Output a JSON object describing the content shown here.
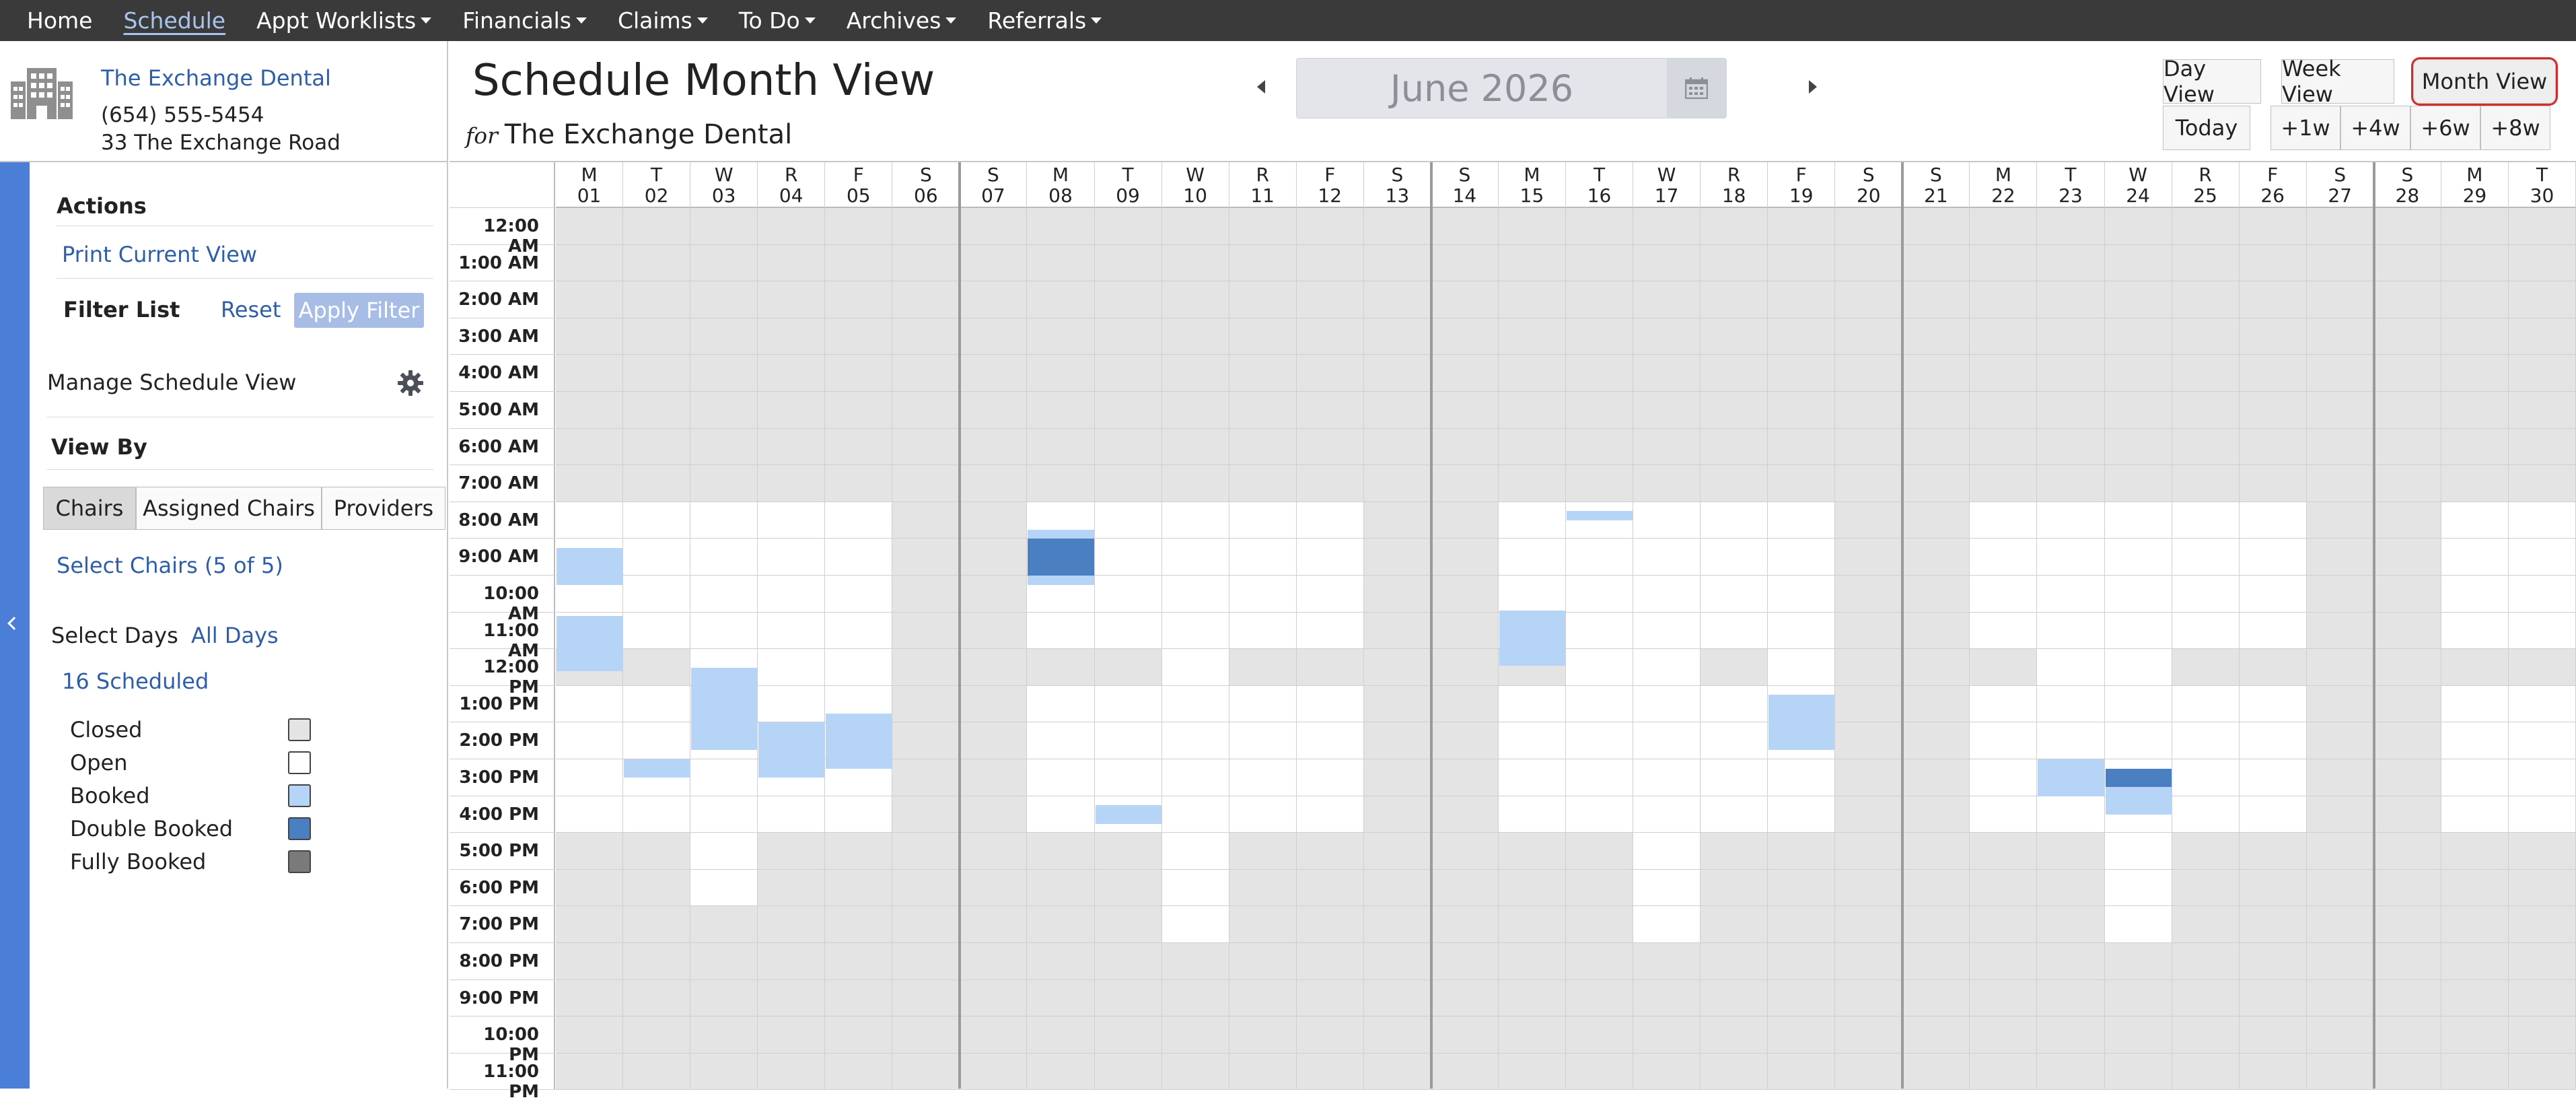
{
  "nav": {
    "items": [
      {
        "label": "Home",
        "dropdown": false,
        "active": false
      },
      {
        "label": "Schedule",
        "dropdown": false,
        "active": true
      },
      {
        "label": "Appt Worklists",
        "dropdown": true,
        "active": false
      },
      {
        "label": "Financials",
        "dropdown": true,
        "active": false
      },
      {
        "label": "Claims",
        "dropdown": true,
        "active": false
      },
      {
        "label": "To Do",
        "dropdown": true,
        "active": false
      },
      {
        "label": "Archives",
        "dropdown": true,
        "active": false
      },
      {
        "label": "Referrals",
        "dropdown": true,
        "active": false
      }
    ]
  },
  "office": {
    "name": "The Exchange Dental",
    "phone": "(654) 555-5454",
    "address": "33 The Exchange Road"
  },
  "header": {
    "title": "Schedule Month View",
    "for_label": "for",
    "location": "The Exchange Dental",
    "month": "June 2026",
    "views": [
      "Day View",
      "Week View",
      "Month View"
    ],
    "selected_view": "Month View",
    "today_label": "Today",
    "jumps": [
      "+1w",
      "+4w",
      "+6w",
      "+8w"
    ]
  },
  "sidebar": {
    "actions_title": "Actions",
    "print_label": "Print Current View",
    "filter_list_label": "Filter List",
    "reset_label": "Reset",
    "apply_label": "Apply Filter",
    "manage_label": "Manage Schedule View",
    "view_by_label": "View By",
    "view_by_options": [
      "Chairs",
      "Assigned Chairs",
      "Providers"
    ],
    "view_by_selected": "Chairs",
    "select_chairs_label": "Select Chairs (5 of 5)",
    "select_days_label": "Select Days",
    "all_days_label": "All Days",
    "scheduled_label": "16 Scheduled",
    "legend": [
      {
        "label": "Closed",
        "color": "#e4e4e4"
      },
      {
        "label": "Open",
        "color": "#ffffff"
      },
      {
        "label": "Booked",
        "color": "#b6d5f6"
      },
      {
        "label": "Double Booked",
        "color": "#4a7fc1"
      },
      {
        "label": "Fully Booked",
        "color": "#7a7a7a"
      }
    ]
  },
  "calendar": {
    "days": [
      {
        "dow": "M",
        "date": "01"
      },
      {
        "dow": "T",
        "date": "02"
      },
      {
        "dow": "W",
        "date": "03"
      },
      {
        "dow": "R",
        "date": "04"
      },
      {
        "dow": "F",
        "date": "05"
      },
      {
        "dow": "S",
        "date": "06"
      },
      {
        "dow": "S",
        "date": "07"
      },
      {
        "dow": "M",
        "date": "08"
      },
      {
        "dow": "T",
        "date": "09"
      },
      {
        "dow": "W",
        "date": "10"
      },
      {
        "dow": "R",
        "date": "11"
      },
      {
        "dow": "F",
        "date": "12"
      },
      {
        "dow": "S",
        "date": "13"
      },
      {
        "dow": "S",
        "date": "14"
      },
      {
        "dow": "M",
        "date": "15"
      },
      {
        "dow": "T",
        "date": "16"
      },
      {
        "dow": "W",
        "date": "17"
      },
      {
        "dow": "R",
        "date": "18"
      },
      {
        "dow": "F",
        "date": "19"
      },
      {
        "dow": "S",
        "date": "20"
      },
      {
        "dow": "S",
        "date": "21"
      },
      {
        "dow": "M",
        "date": "22"
      },
      {
        "dow": "T",
        "date": "23"
      },
      {
        "dow": "W",
        "date": "24"
      },
      {
        "dow": "R",
        "date": "25"
      },
      {
        "dow": "F",
        "date": "26"
      },
      {
        "dow": "S",
        "date": "27"
      },
      {
        "dow": "S",
        "date": "28"
      },
      {
        "dow": "M",
        "date": "29"
      },
      {
        "dow": "T",
        "date": "30"
      }
    ],
    "hours": [
      "12:00 AM",
      "1:00 AM",
      "2:00 AM",
      "3:00 AM",
      "4:00 AM",
      "5:00 AM",
      "6:00 AM",
      "7:00 AM",
      "8:00 AM",
      "9:00 AM",
      "10:00 AM",
      "11:00 AM",
      "12:00 PM",
      "1:00 PM",
      "2:00 PM",
      "3:00 PM",
      "4:00 PM",
      "5:00 PM",
      "6:00 PM",
      "7:00 PM",
      "8:00 PM",
      "9:00 PM",
      "10:00 PM",
      "11:00 PM"
    ],
    "open_hours": {
      "01": [
        8,
        12
      ],
      "02": [
        8,
        17
      ],
      "03": [
        8,
        19
      ],
      "04": [
        8,
        17
      ],
      "05": [
        8,
        17
      ],
      "08": [
        8,
        12
      ],
      "09": [
        8,
        17
      ],
      "10": [
        8,
        20
      ],
      "11": [
        8,
        12
      ],
      "12": [
        8,
        12
      ],
      "15": [
        8,
        12
      ],
      "16": [
        8,
        17
      ],
      "17": [
        8,
        20
      ],
      "18": [
        8,
        12
      ],
      "19": [
        8,
        17
      ],
      "22": [
        8,
        12
      ],
      "23": [
        8,
        17
      ],
      "24": [
        8,
        20
      ],
      "25": [
        8,
        12
      ],
      "26": [
        8,
        12
      ],
      "29": [
        8,
        12
      ],
      "30": [
        8,
        12
      ]
    },
    "closed_gaps": {
      "01": [
        [
          12,
          13
        ],
        [
          17,
          24
        ]
      ],
      "02": [
        [
          12,
          13
        ],
        [
          17,
          24
        ]
      ],
      "08": [
        [
          12,
          13
        ]
      ],
      "09": [
        [
          12,
          13
        ]
      ],
      "11": [
        [
          12,
          13
        ]
      ],
      "12": [
        [
          12,
          13
        ]
      ],
      "15": [
        [
          12,
          13
        ]
      ],
      "18": [
        [
          12,
          13
        ]
      ],
      "22": [
        [
          12,
          13
        ]
      ],
      "25": [
        [
          12,
          13
        ]
      ],
      "26": [
        [
          12,
          13
        ]
      ],
      "29": [
        [
          12,
          13
        ]
      ],
      "30": [
        [
          12,
          13
        ]
      ]
    },
    "extra_open": {
      "01": [
        [
          13,
          17
        ]
      ],
      "08": [
        [
          13,
          17
        ]
      ],
      "11": [
        [
          13,
          17
        ]
      ],
      "12": [
        [
          13,
          17
        ]
      ],
      "15": [
        [
          13,
          17
        ]
      ],
      "18": [
        [
          13,
          17
        ]
      ],
      "22": [
        [
          13,
          17
        ]
      ],
      "25": [
        [
          13,
          17
        ]
      ],
      "26": [
        [
          13,
          17
        ]
      ],
      "29": [
        [
          13,
          17
        ]
      ],
      "30": [
        [
          13,
          17
        ]
      ]
    },
    "booked": [
      {
        "day": "01",
        "start": 9.25,
        "end": 10.25
      },
      {
        "day": "01",
        "start": 11.1,
        "end": 12.6
      },
      {
        "day": "02",
        "start": 15.0,
        "end": 15.5
      },
      {
        "day": "03",
        "start": 12.5,
        "end": 14.75
      },
      {
        "day": "04",
        "start": 14.0,
        "end": 15.5
      },
      {
        "day": "05",
        "start": 13.75,
        "end": 15.25
      },
      {
        "day": "08",
        "start": 8.75,
        "end": 10.25
      },
      {
        "day": "09",
        "start": 16.25,
        "end": 16.75
      },
      {
        "day": "15",
        "start": 10.95,
        "end": 12.45
      },
      {
        "day": "16",
        "start": 8.25,
        "end": 8.5
      },
      {
        "day": "19",
        "start": 13.25,
        "end": 14.75
      },
      {
        "day": "23",
        "start": 15.0,
        "end": 16.0
      },
      {
        "day": "24",
        "start": 15.5,
        "end": 16.5
      }
    ],
    "double_booked": [
      {
        "day": "08",
        "start": 9.0,
        "end": 10.0
      },
      {
        "day": "24",
        "start": 15.25,
        "end": 15.75
      }
    ]
  }
}
